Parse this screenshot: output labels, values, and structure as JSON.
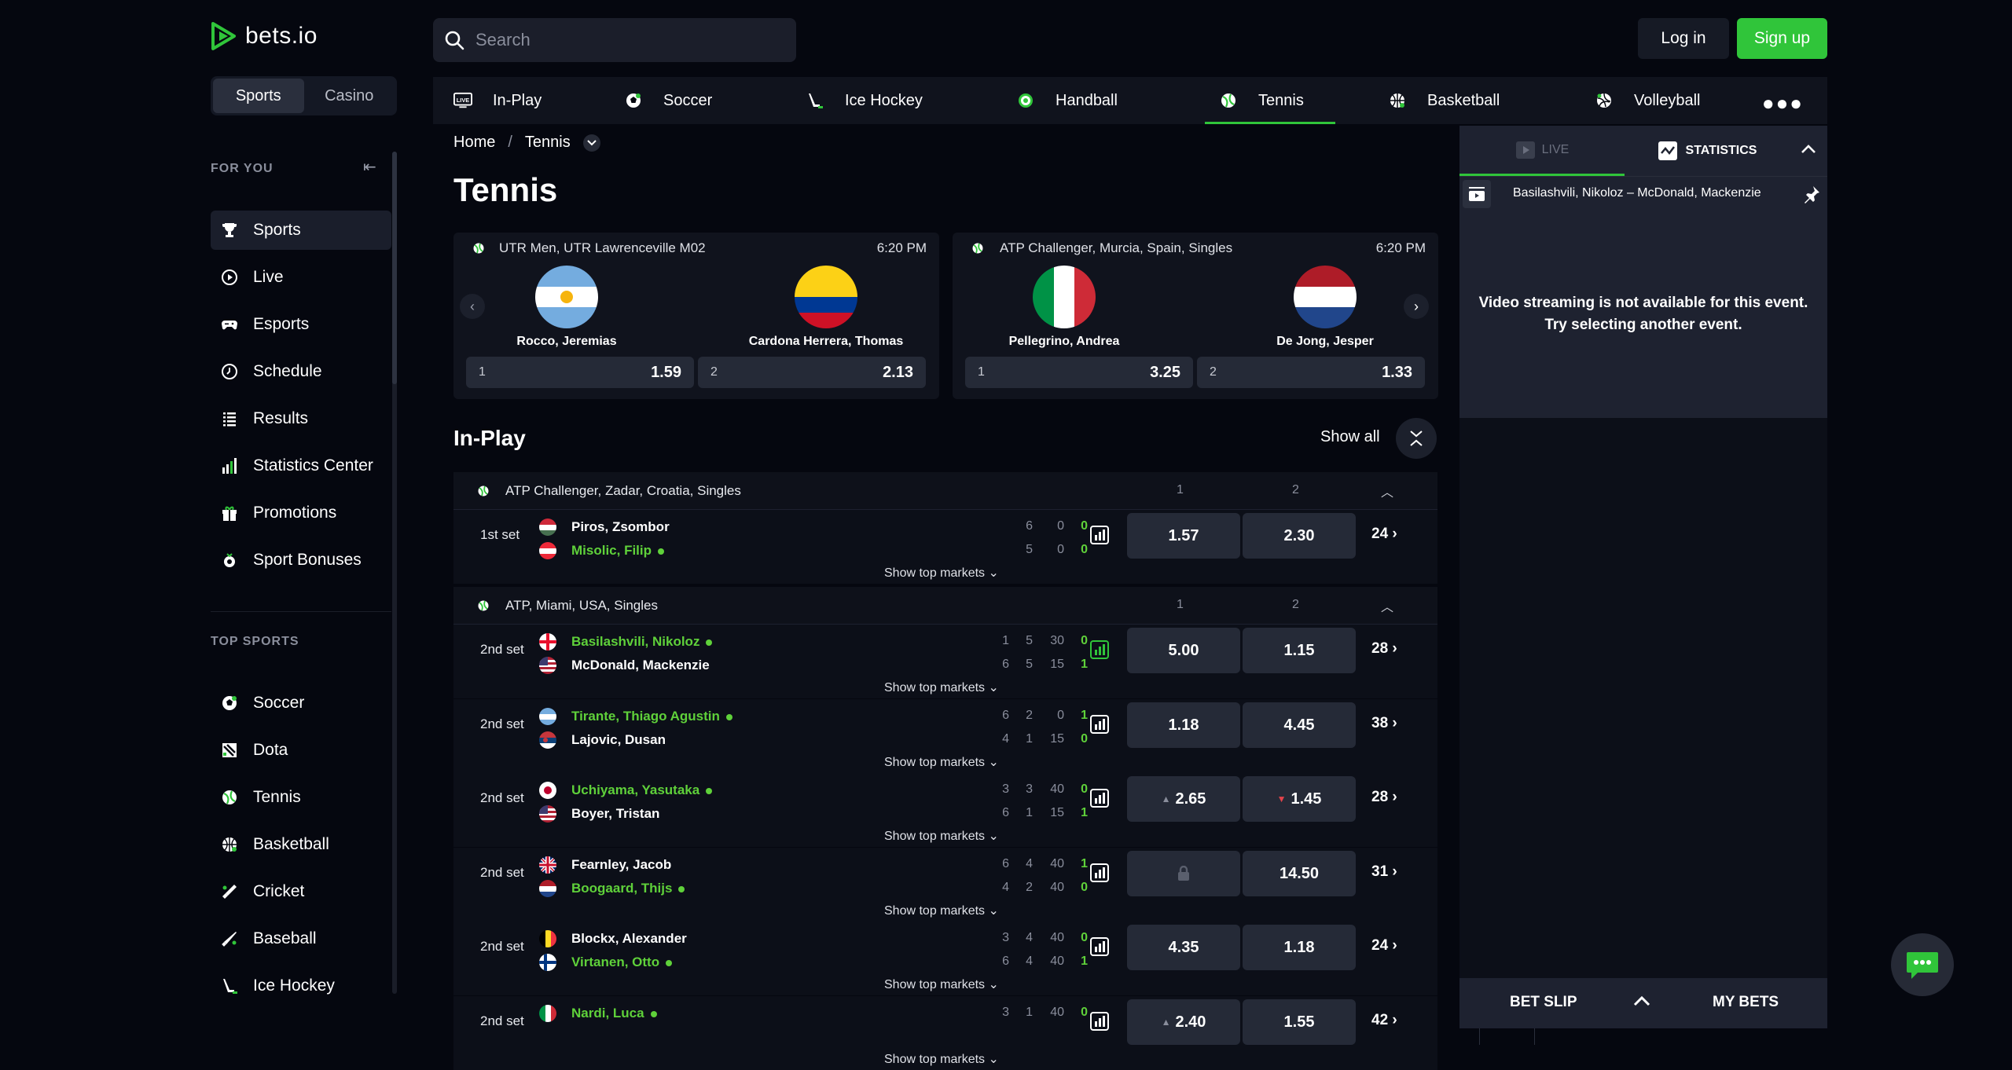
{
  "header": {
    "logo_text": "bets.io",
    "search_placeholder": "Search",
    "login_label": "Log in",
    "signup_label": "Sign up"
  },
  "sidebar": {
    "modes": [
      "Sports",
      "Casino"
    ],
    "for_you_heading": "FOR YOU",
    "top_sports_heading": "TOP SPORTS",
    "for_you_items": [
      {
        "label": "Sports",
        "icon": "trophy-icon"
      },
      {
        "label": "Live",
        "icon": "live-icon"
      },
      {
        "label": "Esports",
        "icon": "gamepad-icon"
      },
      {
        "label": "Schedule",
        "icon": "clock-icon"
      },
      {
        "label": "Results",
        "icon": "list-icon"
      },
      {
        "label": "Statistics Center",
        "icon": "bar-chart-icon"
      },
      {
        "label": "Promotions",
        "icon": "gift-icon"
      },
      {
        "label": "Sport Bonuses",
        "icon": "bonus-icon"
      }
    ],
    "top_sports_items": [
      {
        "label": "Soccer",
        "icon": "soccer-ball-icon"
      },
      {
        "label": "Dota",
        "icon": "dota-icon"
      },
      {
        "label": "Tennis",
        "icon": "tennis-ball-icon"
      },
      {
        "label": "Basketball",
        "icon": "basketball-icon"
      },
      {
        "label": "Cricket",
        "icon": "cricket-icon"
      },
      {
        "label": "Baseball",
        "icon": "baseball-icon"
      },
      {
        "label": "Ice Hockey",
        "icon": "ice-hockey-icon"
      }
    ]
  },
  "sport_tabs": {
    "items": [
      {
        "label": "In-Play",
        "icon": "live-tv-icon"
      },
      {
        "label": "Soccer",
        "icon": "soccer-ball-icon"
      },
      {
        "label": "Ice Hockey",
        "icon": "ice-hockey-icon"
      },
      {
        "label": "Handball",
        "icon": "handball-icon"
      },
      {
        "label": "Tennis",
        "icon": "tennis-ball-icon"
      },
      {
        "label": "Basketball",
        "icon": "basketball-icon"
      },
      {
        "label": "Volleyball",
        "icon": "volleyball-icon"
      }
    ],
    "active": "Tennis"
  },
  "breadcrumb": {
    "home": "Home",
    "separator": "/",
    "current": "Tennis"
  },
  "page_title": "Tennis",
  "featured": [
    {
      "league": "UTR Men, UTR Lawrenceville M02",
      "time": "6:20 PM",
      "p1": "Rocco, Jeremias",
      "p2": "Cardona Herrera, Thomas",
      "o1_label": "1",
      "o1": "1.59",
      "o2_label": "2",
      "o2": "2.13"
    },
    {
      "league": "ATP Challenger, Murcia, Spain, Singles",
      "time": "6:20 PM",
      "p1": "Pellegrino, Andrea",
      "p2": "De Jong, Jesper",
      "o1_label": "1",
      "o1": "3.25",
      "o2_label": "2",
      "o2": "1.33"
    }
  ],
  "inplay": {
    "title": "In-Play",
    "show_all": "Show all",
    "show_top_markets": "Show top markets",
    "leagues": [
      {
        "name": "ATP Challenger, Zadar, Croatia, Singles",
        "col1": "1",
        "col2": "2"
      },
      {
        "name": "ATP, Miami, USA, Singles",
        "col1": "1",
        "col2": "2"
      }
    ],
    "matches": [
      {
        "period": "1st set",
        "p1": "Piros, Zsombor",
        "p2": "Misolic, Filip",
        "serve": 2,
        "s1": [
          "",
          "6",
          "0",
          "0"
        ],
        "s2": [
          "",
          "5",
          "0",
          "0"
        ],
        "o1": "1.57",
        "o2": "2.30",
        "more": "24"
      },
      {
        "period": "2nd set",
        "p1": "Basilashvili, Nikoloz",
        "p2": "McDonald, Mackenzie",
        "serve": 1,
        "s1": [
          "1",
          "5",
          "30",
          "0"
        ],
        "s2": [
          "6",
          "5",
          "15",
          "1"
        ],
        "o1": "5.00",
        "o2": "1.15",
        "more": "28"
      },
      {
        "period": "2nd set",
        "p1": "Tirante, Thiago Agustin",
        "p2": "Lajovic, Dusan",
        "serve": 1,
        "s1": [
          "6",
          "2",
          "0",
          "1"
        ],
        "s2": [
          "4",
          "1",
          "15",
          "0"
        ],
        "o1": "1.18",
        "o2": "4.45",
        "more": "38"
      },
      {
        "period": "2nd set",
        "p1": "Uchiyama, Yasutaka",
        "p2": "Boyer, Tristan",
        "serve": 1,
        "s1": [
          "3",
          "3",
          "40",
          "0"
        ],
        "s2": [
          "6",
          "1",
          "15",
          "1"
        ],
        "o1": "2.65",
        "o2": "1.45",
        "more": "28"
      },
      {
        "period": "2nd set",
        "p1": "Fearnley, Jacob",
        "p2": "Boogaard, Thijs",
        "serve": 2,
        "s1": [
          "6",
          "4",
          "40",
          "1"
        ],
        "s2": [
          "4",
          "2",
          "40",
          "0"
        ],
        "o1": "",
        "o2": "14.50",
        "more": "31"
      },
      {
        "period": "2nd set",
        "p1": "Blockx, Alexander",
        "p2": "Virtanen, Otto",
        "serve": 2,
        "s1": [
          "3",
          "4",
          "40",
          "0"
        ],
        "s2": [
          "6",
          "4",
          "40",
          "1"
        ],
        "o1": "4.35",
        "o2": "1.18",
        "more": "24"
      },
      {
        "period": "2nd set",
        "p1": "Nardi, Luca",
        "p2": "",
        "serve": 1,
        "s1": [
          "3",
          "1",
          "40",
          "0"
        ],
        "s2": [
          "",
          "",
          "",
          ""
        ],
        "o1": "2.40",
        "o2": "1.55",
        "more": "42"
      }
    ]
  },
  "right_panel": {
    "tab_live": "LIVE",
    "tab_statistics": "STATISTICS",
    "event": "Basilashvili, Nikoloz – McDonald, Mackenzie",
    "message_line1": "Video streaming is not available for this event.",
    "message_line2": "Try selecting another event."
  },
  "betslip": {
    "bet_slip": "BET SLIP",
    "my_bets": "MY BETS"
  },
  "colors": {
    "accent": "#30c53a",
    "serve_green": "#5fd13a",
    "bg": "#05070f",
    "panel": "#1e2230",
    "odds_button": "#252a37",
    "down": "#e2434b"
  }
}
